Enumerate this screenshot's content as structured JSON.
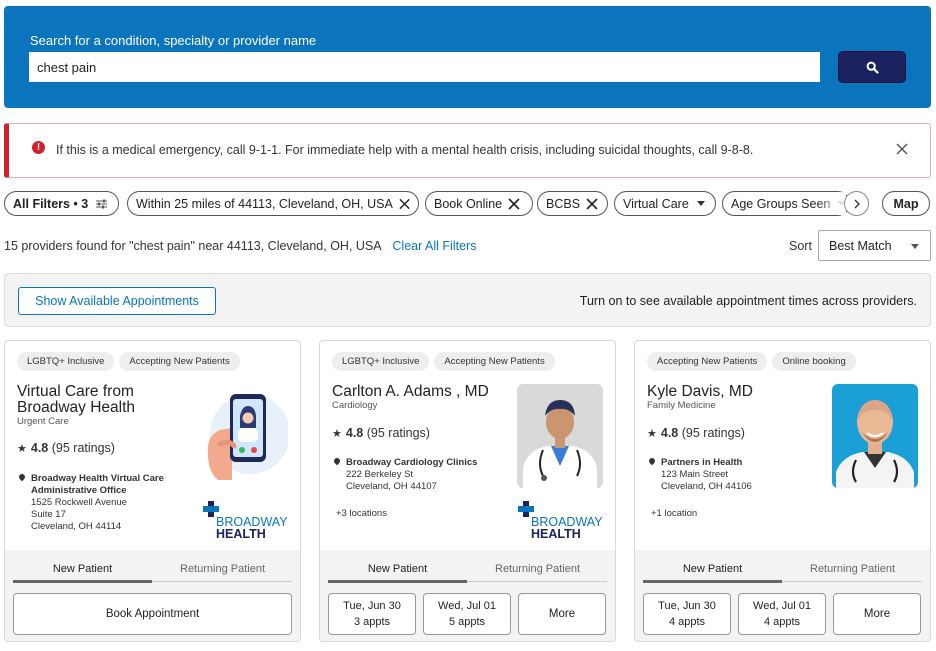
{
  "search": {
    "label": "Search for a condition, specialty or provider name",
    "value": "chest pain",
    "button_icon": "search-icon"
  },
  "alert": {
    "icon": "exclamation-circle-icon",
    "message": "If this is a medical emergency, call 9-1-1. For immediate help with a mental health crisis, including suicidal thoughts, call 9-8-8.",
    "close_icon": "close-icon",
    "color": "#d0202e"
  },
  "filters": {
    "all_filters": "All Filters • 3",
    "chips": [
      {
        "label": "Within 25 miles of 44113, Cleveland, OH, USA",
        "removable": true
      },
      {
        "label": "Book Online",
        "removable": true
      },
      {
        "label": "BCBS",
        "removable": true
      },
      {
        "label": "Virtual Care",
        "dropdown": true
      },
      {
        "label": "Age Groups Seen",
        "dropdown": true
      }
    ],
    "map_label": "Map"
  },
  "results": {
    "summary": "15 providers found for \"chest pain\" near 44113, Cleveland, OH, USA",
    "clear_label": "Clear All Filters",
    "sort_label": "Sort",
    "sort_value": "Best Match"
  },
  "availability": {
    "button_label": "Show Available Appointments",
    "note": "Turn on to see available appointment times across providers."
  },
  "colors": {
    "brand_blue": "#0a75bd",
    "search_button": "#1c2160",
    "alert_red": "#d0202e"
  },
  "cards": [
    {
      "tags": [
        "LGBTQ+ Inclusive",
        "Accepting New Patients"
      ],
      "name": "Virtual Care from Broadway Health",
      "specialty": "Urgent Care",
      "rating": "4.8",
      "ratings_count": "(95 ratings)",
      "office": "Broadway Health Virtual Care Administrative Office",
      "address": [
        "1525 Rockwell Avenue",
        "Suite 17",
        "Cleveland, OH 44114"
      ],
      "more_locations": "",
      "logo_top": "BROADWAY",
      "logo_bottom": "HEALTH",
      "tab_new": "New Patient",
      "tab_returning": "Returning Patient",
      "book_label": "Book Appointment"
    },
    {
      "tags": [
        "LGBTQ+ Inclusive",
        "Accepting New Patients"
      ],
      "name": "Carlton A. Adams , MD",
      "specialty": "Cardiology",
      "rating": "4.8",
      "ratings_count": "(95 ratings)",
      "office": "Broadway Cardiology Clinics",
      "address": [
        "222 Berkeley St",
        "Cleveland, OH 44107"
      ],
      "more_locations": "+3 locations",
      "logo_top": "BROADWAY",
      "logo_bottom": "HEALTH",
      "tab_new": "New Patient",
      "tab_returning": "Returning Patient",
      "slots": [
        {
          "date": "Tue, Jun 30",
          "count": "3 appts"
        },
        {
          "date": "Wed, Jul 01",
          "count": "5 appts"
        }
      ],
      "more_label": "More"
    },
    {
      "tags": [
        "Accepting New Patients",
        "Online booking"
      ],
      "name": "Kyle Davis, MD",
      "specialty": "Family Medicine",
      "rating": "4.8",
      "ratings_count": "(95 ratings)",
      "office": "Partners in Health",
      "address": [
        "123 Main Street",
        "Cleveland, OH 44106"
      ],
      "more_locations": "+1 location",
      "tab_new": "New Patient",
      "tab_returning": "Returning Patient",
      "slots": [
        {
          "date": "Tue, Jun 30",
          "count": "4 appts"
        },
        {
          "date": "Wed, Jul 01",
          "count": "4 appts"
        }
      ],
      "more_label": "More"
    }
  ]
}
